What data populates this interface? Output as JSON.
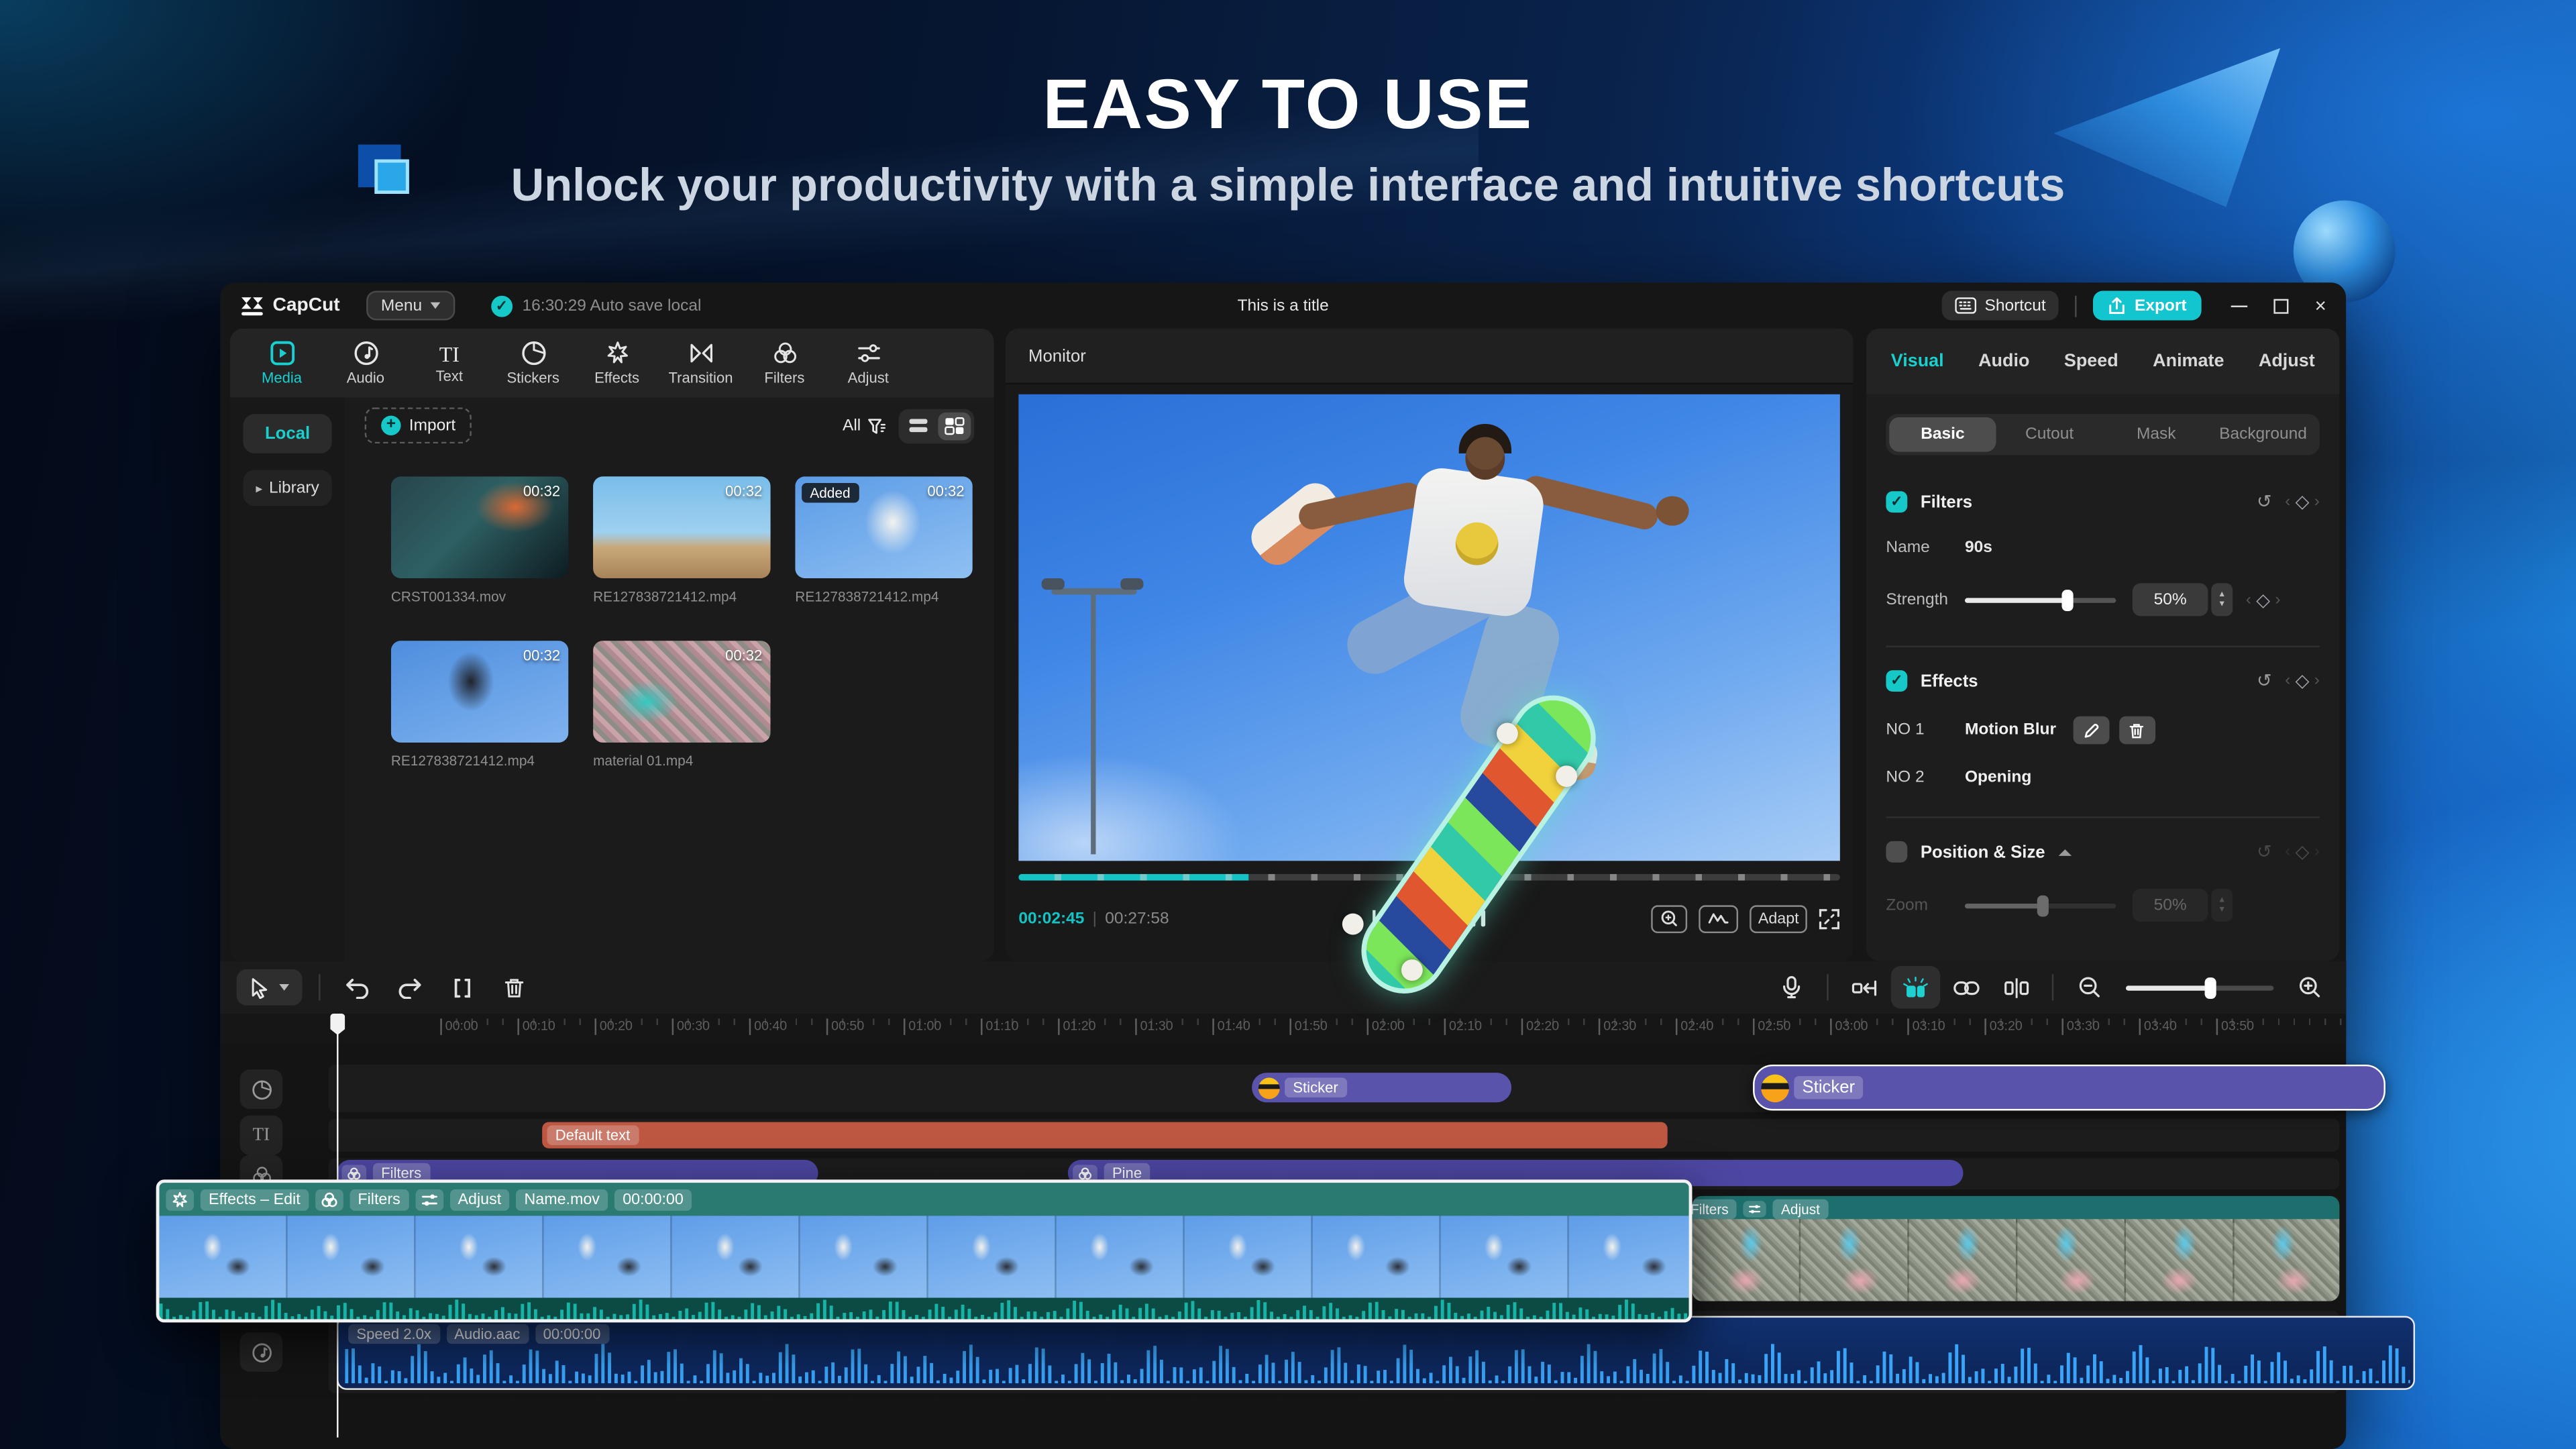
{
  "hero": {
    "title": "EASY TO USE",
    "subtitle": "Unlock your productivity with a simple interface and intuitive shortcuts"
  },
  "titlebar": {
    "app_name": "CapCut",
    "menu_label": "Menu",
    "autosave_text": "16:30:29 Auto save local",
    "document_title": "This is a title",
    "shortcut_label": "Shortcut",
    "export_label": "Export"
  },
  "media_toolbar": {
    "items": [
      {
        "label": "Media",
        "icon": "media-icon",
        "active": true
      },
      {
        "label": "Audio",
        "icon": "audio-icon"
      },
      {
        "label": "Text",
        "icon": "text-icon"
      },
      {
        "label": "Stickers",
        "icon": "stickers-icon"
      },
      {
        "label": "Effects",
        "icon": "effects-icon"
      },
      {
        "label": "Transition",
        "icon": "transition-icon"
      },
      {
        "label": "Filters",
        "icon": "filters-icon"
      },
      {
        "label": "Adjust",
        "icon": "adjust-icon"
      }
    ]
  },
  "media_panel": {
    "local_label": "Local",
    "library_label": "Library",
    "import_label": "Import",
    "filter_all_label": "All",
    "items": [
      {
        "name": "CRST001334.mov",
        "duration": "00:32",
        "badge": ""
      },
      {
        "name": "RE127838721412.mp4",
        "duration": "00:32",
        "badge": ""
      },
      {
        "name": "RE127838721412.mp4",
        "duration": "00:32",
        "badge": "Added"
      },
      {
        "name": "RE127838721412.mp4",
        "duration": "00:32",
        "badge": ""
      },
      {
        "name": "material 01.mp4",
        "duration": "00:32",
        "badge": ""
      }
    ]
  },
  "monitor": {
    "title": "Monitor",
    "current_time": "00:02:45",
    "total_time": "00:27:58",
    "adapt_label": "Adapt"
  },
  "inspector": {
    "tabs": [
      {
        "label": "Visual",
        "active": true
      },
      {
        "label": "Audio"
      },
      {
        "label": "Speed"
      },
      {
        "label": "Animate"
      },
      {
        "label": "Adjust"
      }
    ],
    "subtabs": [
      {
        "label": "Basic",
        "active": true
      },
      {
        "label": "Cutout"
      },
      {
        "label": "Mask"
      },
      {
        "label": "Background"
      }
    ],
    "filters_section": {
      "label": "Filters",
      "name_label": "Name",
      "name_value": "90s",
      "strength_label": "Strength",
      "strength_value": "50%"
    },
    "effects_section": {
      "label": "Effects",
      "items": [
        {
          "no": "NO 1",
          "name": "Motion Blur"
        },
        {
          "no": "NO 2",
          "name": "Opening"
        }
      ]
    },
    "position_section": {
      "label": "Position & Size",
      "zoom_label": "Zoom",
      "zoom_value": "50%"
    }
  },
  "timeline": {
    "ruler_labels": [
      "00:00",
      "00:10",
      "00:20",
      "00:30",
      "00:40",
      "00:50",
      "01:00",
      "01:10",
      "01:20",
      "01:30",
      "01:40",
      "01:50",
      "02:00",
      "02:10",
      "02:20",
      "02:30",
      "02:40",
      "02:50",
      "03:00",
      "03:10",
      "03:20",
      "03:30",
      "03:40",
      "03:50"
    ],
    "sticker_clip_1": {
      "label": "Sticker"
    },
    "sticker_clip_2": {
      "label": "Sticker"
    },
    "text_clip": {
      "label": "Default text"
    },
    "filter_clip_1": {
      "label": "Filters"
    },
    "filter_clip_2": {
      "label": "Pine"
    },
    "video_clip_right": {
      "badge_filters": "Filters",
      "badge_adjust": "Adjust"
    },
    "inset_clip": {
      "badge_effects": "Effects – Edit",
      "badge_filters": "Filters",
      "badge_adjust": "Adjust",
      "badge_name": "Name.mov",
      "badge_time": "00:00:00"
    },
    "audio_clip": {
      "badge_speed": "Speed 2.0x",
      "badge_name": "Audio.aac",
      "badge_time": "00:00:00"
    }
  },
  "colors": {
    "accent": "#17c8c8",
    "export_bg": "#13c5ce",
    "sticker_purple": "#5a53ab",
    "filter_purple": "#4c47a2",
    "text_clip_orange": "#bd5742",
    "video_clip_teal": "#2a7a72",
    "audio_clip_blue": "#10306e",
    "waveform_blue": "#3aa4f8"
  }
}
